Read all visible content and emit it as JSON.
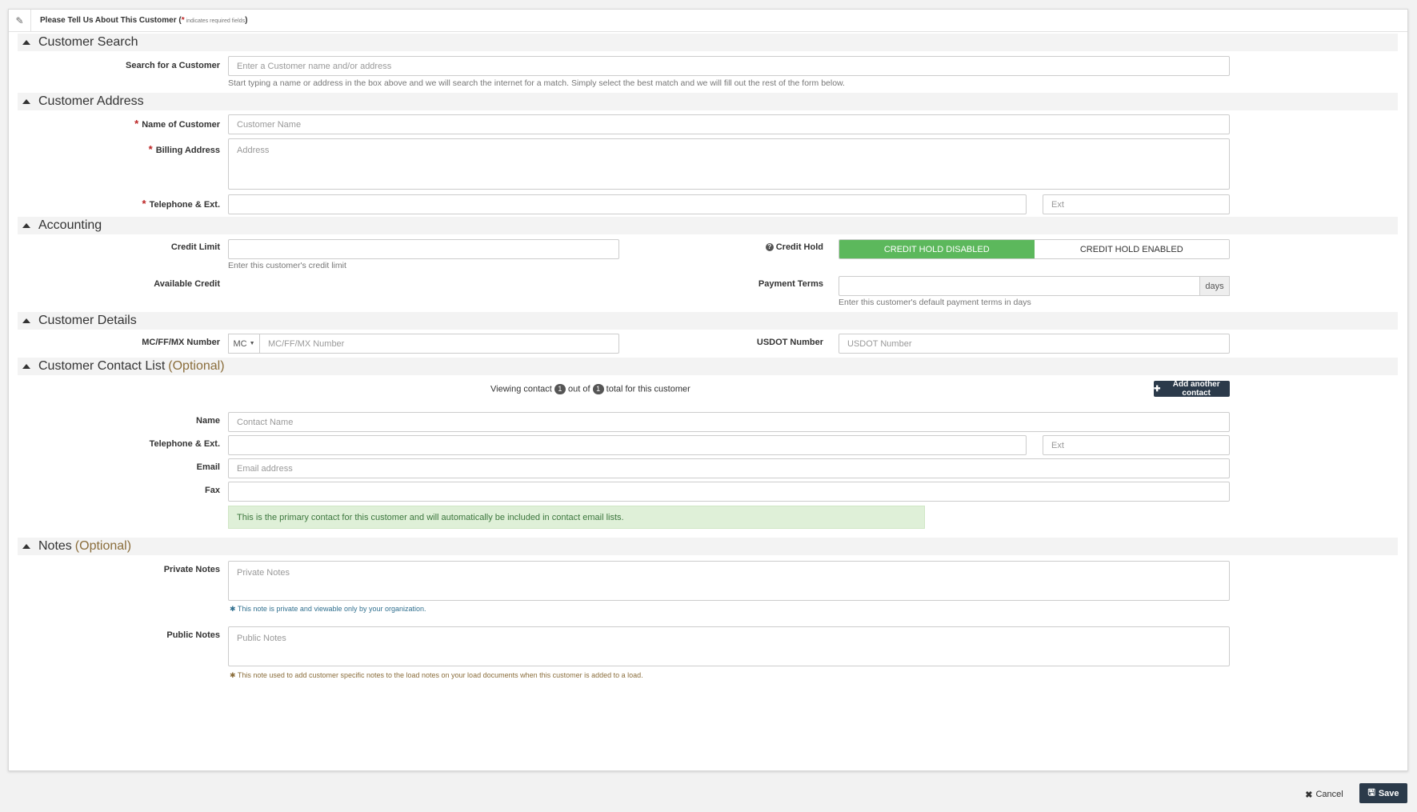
{
  "header": {
    "title_prefix": "Please Tell Us About This Customer (",
    "required_star": "*",
    "required_note": " indicates required fields",
    "title_suffix": ")"
  },
  "sections": {
    "customer_search": "Customer Search",
    "customer_address": "Customer Address",
    "accounting": "Accounting",
    "customer_details": "Customer Details",
    "contact_list": "Customer Contact List",
    "contact_list_optional": "(Optional)",
    "notes": "Notes",
    "notes_optional": "(Optional)"
  },
  "search": {
    "label": "Search for a Customer",
    "placeholder": "Enter a Customer name and/or address",
    "help": "Start typing a name or address in the box above and we will search the internet for a match. Simply select the best match and we will fill out the rest of the form below."
  },
  "address": {
    "star": "*",
    "name_label": "Name of Customer",
    "name_placeholder": "Customer Name",
    "billing_label": "Billing Address",
    "billing_placeholder": "Address",
    "phone_label": "Telephone & Ext.",
    "ext_placeholder": "Ext"
  },
  "accounting": {
    "credit_limit_label": "Credit Limit",
    "credit_limit_help": "Enter this customer's credit limit",
    "available_credit_label": "Available Credit",
    "credit_hold_label": "Credit Hold",
    "credit_hold_icon": "?",
    "hold_disabled": "CREDIT HOLD DISABLED",
    "hold_enabled": "CREDIT HOLD ENABLED",
    "payment_terms_label": "Payment Terms",
    "payment_terms_unit": "days",
    "payment_terms_help": "Enter this customer's default payment terms in days"
  },
  "details": {
    "mc_label": "MC/FF/MX Number",
    "mc_prefix": "MC",
    "mc_placeholder": "MC/FF/MX Number",
    "usdot_label": "USDOT Number",
    "usdot_placeholder": "USDOT Number"
  },
  "contacts": {
    "viewing_prefix": "Viewing contact",
    "current": "1",
    "out_of": "out of",
    "total": "1",
    "viewing_suffix": "total for this customer",
    "add_button": "Add another contact",
    "name_label": "Name",
    "name_placeholder": "Contact Name",
    "phone_label": "Telephone & Ext.",
    "ext_placeholder": "Ext",
    "email_label": "Email",
    "email_placeholder": "Email address",
    "fax_label": "Fax",
    "primary_notice": "This is the primary contact for this customer and will automatically be included in contact email lists."
  },
  "notes": {
    "private_label": "Private Notes",
    "private_placeholder": "Private Notes",
    "private_help": "This note is private and viewable only by your organization.",
    "public_label": "Public Notes",
    "public_placeholder": "Public Notes",
    "public_help": "This note used to add customer specific notes to the load notes on your load documents when this customer is added to a load."
  },
  "footer": {
    "cancel": "Cancel",
    "save": "Save"
  },
  "colors": {
    "success": "#5cb85c",
    "dark_button": "#2b3a4a",
    "required": "#bb2222",
    "optional": "#8a6d3b"
  }
}
